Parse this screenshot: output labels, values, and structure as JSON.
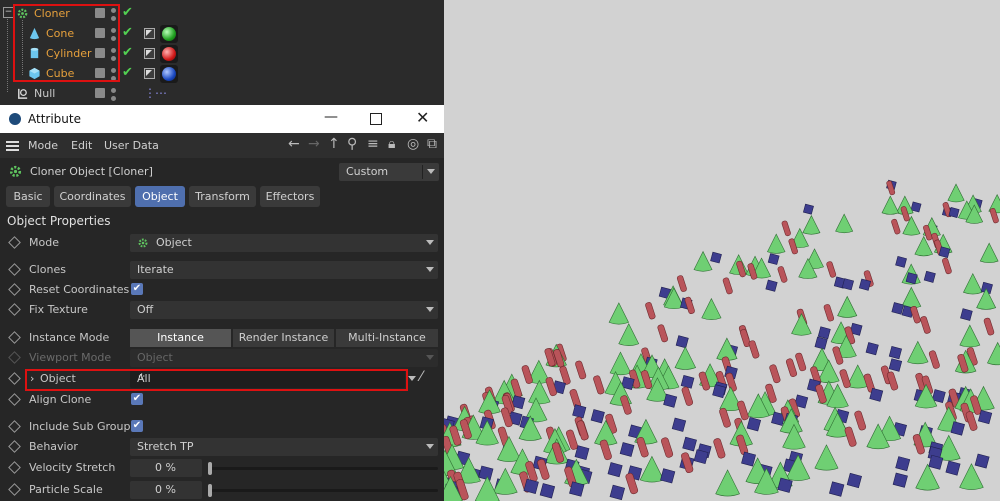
{
  "object_manager": {
    "rows": [
      {
        "name": "Cloner"
      },
      {
        "name": "Cone"
      },
      {
        "name": "Cylinder"
      },
      {
        "name": "Cube"
      },
      {
        "name": "Null"
      }
    ]
  },
  "window": {
    "title": "Attribute"
  },
  "menu": {
    "mode": "Mode",
    "edit": "Edit",
    "user_data": "User Data"
  },
  "object_header": {
    "title": "Cloner Object [Cloner]",
    "mode_value": "Custom"
  },
  "tabs": [
    "Basic",
    "Coordinates",
    "Object",
    "Transform",
    "Effectors"
  ],
  "section_title": "Object Properties",
  "properties": {
    "mode": {
      "label": "Mode",
      "value": "Object"
    },
    "clones": {
      "label": "Clones",
      "value": "Iterate"
    },
    "reset_coordinates": {
      "label": "Reset Coordinates"
    },
    "fix_texture": {
      "label": "Fix Texture",
      "value": "Off"
    },
    "instance_mode": {
      "label": "Instance Mode",
      "options": [
        "Instance",
        "Render Instance",
        "Multi-Instance"
      ]
    },
    "viewport_mode": {
      "label": "Viewport Mode",
      "value": "Object"
    },
    "object": {
      "label": "Object",
      "value": "All"
    },
    "align_clone": {
      "label": "Align Clone"
    },
    "include_sub_groups": {
      "label": "Include Sub Groups"
    },
    "behavior": {
      "label": "Behavior",
      "value": "Stretch TP"
    },
    "velocity_stretch": {
      "label": "Velocity Stretch",
      "value": "0 %"
    },
    "particle_scale": {
      "label": "Particle Scale",
      "value": "0 %"
    }
  },
  "colors": {
    "accent_tab": "#4f6fae",
    "highlight_box": "#d11111",
    "cone_green": "#6fcf73",
    "cylinder_red": "#b9545a",
    "cube_blue": "#3d3d8e",
    "viewport_bg": "#d2d2d2"
  }
}
